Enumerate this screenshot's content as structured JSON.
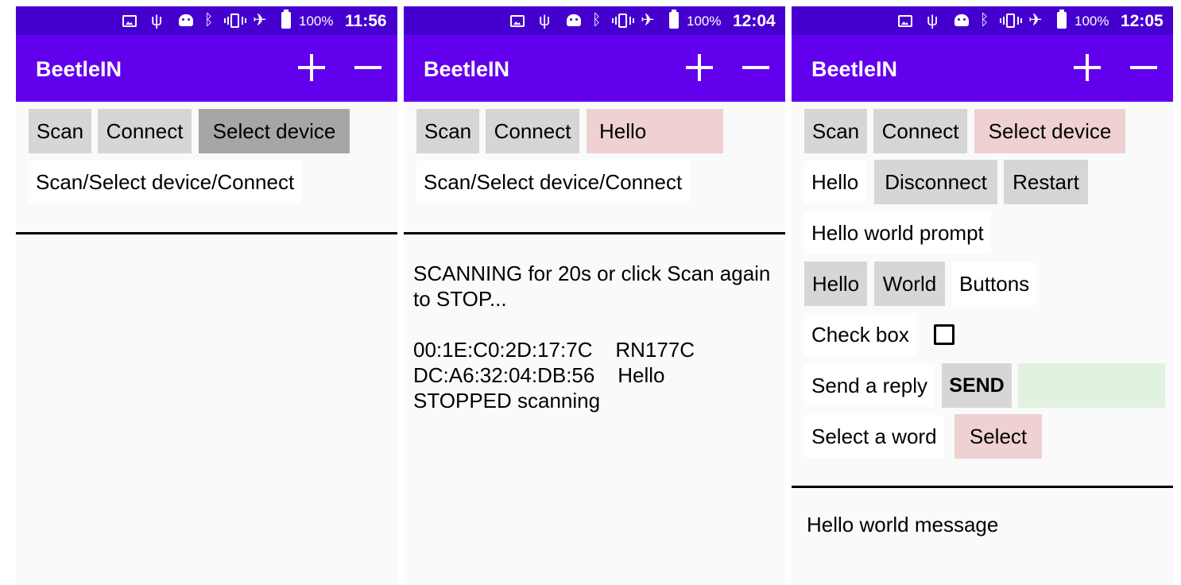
{
  "app": {
    "title": "BeetleIN"
  },
  "screens": [
    {
      "status": {
        "battery": "100%",
        "time": "11:56"
      },
      "buttons": {
        "scan": "Scan",
        "connect": "Connect",
        "select": "Select device"
      },
      "hint": "Scan/Select device/Connect"
    },
    {
      "status": {
        "battery": "100%",
        "time": "12:04"
      },
      "buttons": {
        "scan": "Scan",
        "connect": "Connect",
        "select": "Hello"
      },
      "hint": "Scan/Select device/Connect",
      "log": {
        "line1": "SCANNING for 20s or click Scan again",
        "line2": "to STOP...",
        "device1": "00:1E:C0:2D:17:7C    RN177C",
        "device2": "DC:A6:32:04:DB:56    Hello",
        "line3": "STOPPED scanning"
      }
    },
    {
      "status": {
        "battery": "100%",
        "time": "12:05"
      },
      "buttons": {
        "scan": "Scan",
        "connect": "Connect",
        "select": "Select device"
      },
      "row2": {
        "device": "Hello",
        "disconnect": "Disconnect",
        "restart": "Restart"
      },
      "prompt": "Hello world prompt",
      "row4": {
        "hello": "Hello",
        "world": "World",
        "label": "Buttons"
      },
      "checkbox_label": "Check box",
      "reply": {
        "label": "Send a reply",
        "send": "SEND",
        "value": ""
      },
      "word": {
        "label": "Select a word",
        "select": "Select"
      },
      "message": "Hello world message"
    }
  ]
}
